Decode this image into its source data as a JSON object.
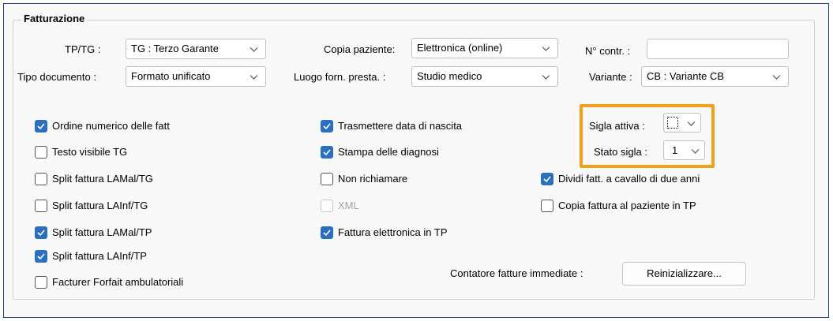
{
  "group": {
    "title": "Fatturazione"
  },
  "fields": {
    "tp_tg": {
      "label": "TP/TG :",
      "value": "TG : Terzo Garante"
    },
    "copia_paziente": {
      "label": "Copia paziente:",
      "value": "Elettronica (online)"
    },
    "n_contr": {
      "label": "N° contr. :",
      "value": ""
    },
    "tipo_documento": {
      "label": "Tipo documento :",
      "value": "Formato unificato"
    },
    "luogo": {
      "label": "Luogo forn. presta. :",
      "value": "Studio medico"
    },
    "variante": {
      "label": "Variante :",
      "value": "CB : Variante CB"
    },
    "sigla_attiva": {
      "label": "Sigla attiva :",
      "value": ""
    },
    "stato_sigla": {
      "label": "Stato sigla :",
      "value": "1"
    }
  },
  "checkboxes": {
    "ordine": {
      "label": "Ordine numerico delle fatt",
      "checked": true
    },
    "testo_tg": {
      "label": "Testo visibile TG",
      "checked": false
    },
    "split_lamal_tg": {
      "label": "Split fattura LAMal/TG",
      "checked": false
    },
    "split_lainf_tg": {
      "label": "Split fattura LAInf/TG",
      "checked": false
    },
    "split_lamal_tp": {
      "label": "Split fattura LAMal/TP",
      "checked": true
    },
    "split_lainf_tp": {
      "label": "Split fattura LAInf/TP",
      "checked": true
    },
    "forfait": {
      "label": "Facturer Forfait ambulatoriali",
      "checked": false
    },
    "trasmettere": {
      "label": "Trasmettere data di nascita",
      "checked": true
    },
    "stampa_diagnosi": {
      "label": "Stampa delle diagnosi",
      "checked": true
    },
    "non_richiamare": {
      "label": "Non richiamare",
      "checked": false
    },
    "xml": {
      "label": "XML",
      "checked": false,
      "disabled": true
    },
    "fattura_elettronica": {
      "label": "Fattura elettronica in TP",
      "checked": true
    },
    "dividi": {
      "label": "Dividi fatt. a cavallo di due anni",
      "checked": true
    },
    "copia_fattura": {
      "label": "Copia fattura al paziente in TP",
      "checked": false
    }
  },
  "contatore": {
    "label": "Contatore fatture immediate :",
    "button": "Reinizializzare..."
  },
  "colors": {
    "accent": "#2a6fc0",
    "highlight": "#f0a21b",
    "frame": "#1f3a80"
  },
  "icons": {
    "dropdown": "chevron-down-icon",
    "check": "checkmark-icon"
  }
}
